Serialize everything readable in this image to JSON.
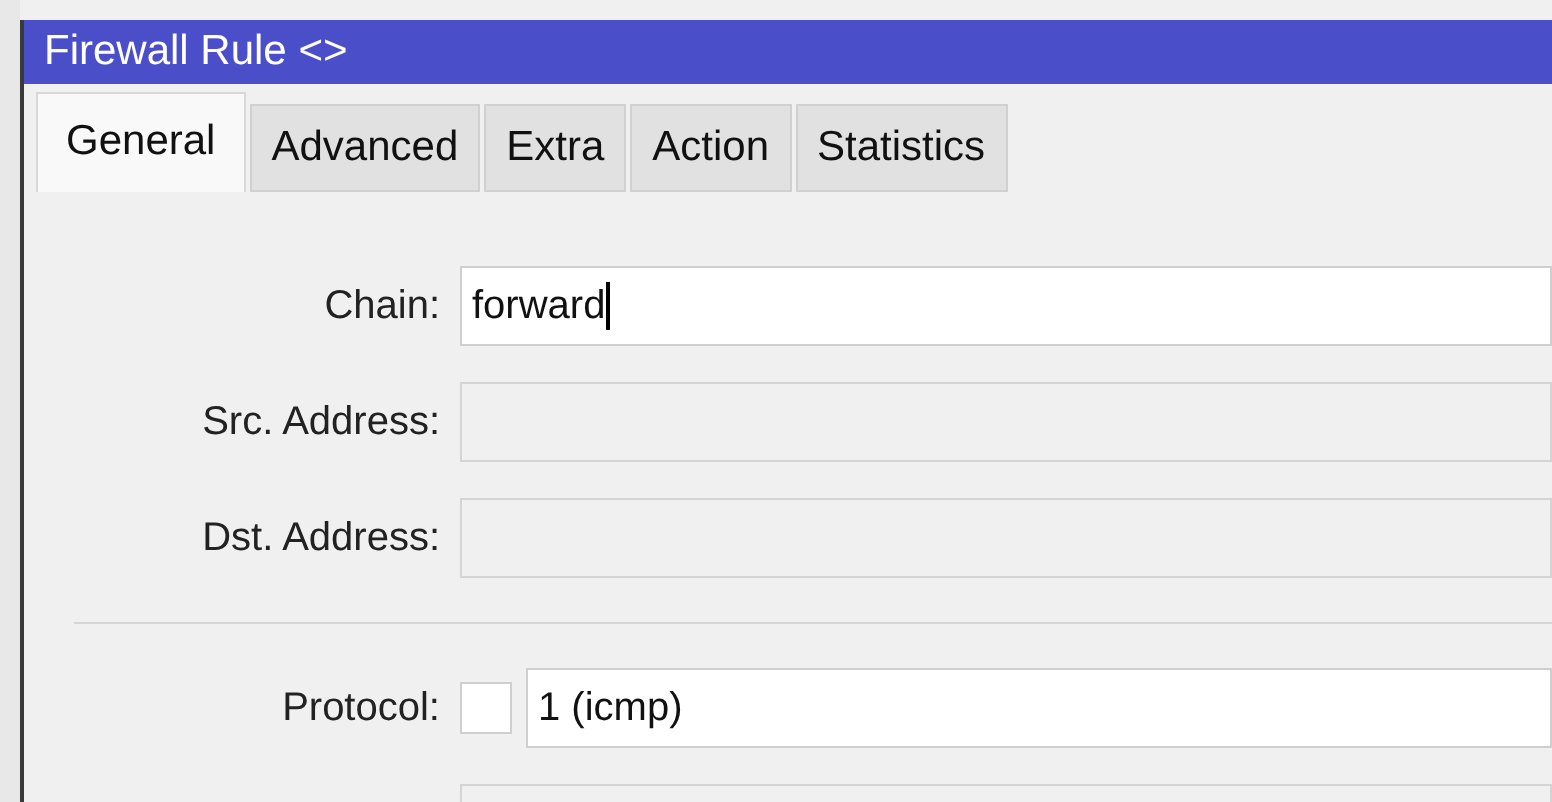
{
  "window": {
    "title": "Firewall Rule <>"
  },
  "tabs": [
    {
      "label": "General",
      "selected": true
    },
    {
      "label": "Advanced",
      "selected": false
    },
    {
      "label": "Extra",
      "selected": false
    },
    {
      "label": "Action",
      "selected": false
    },
    {
      "label": "Statistics",
      "selected": false
    }
  ],
  "fields": [
    {
      "kind": "text",
      "label": "Chain:",
      "value": "forward",
      "focused": true,
      "disabled": false
    },
    {
      "kind": "text",
      "label": "Src. Address:",
      "disabled": true
    },
    {
      "kind": "text",
      "label": "Dst. Address:",
      "disabled": true
    },
    {
      "kind": "divider"
    },
    {
      "kind": "negatable",
      "label": "Protocol:",
      "value": "1 (icmp)",
      "checked": false,
      "disabled": false
    }
  ]
}
